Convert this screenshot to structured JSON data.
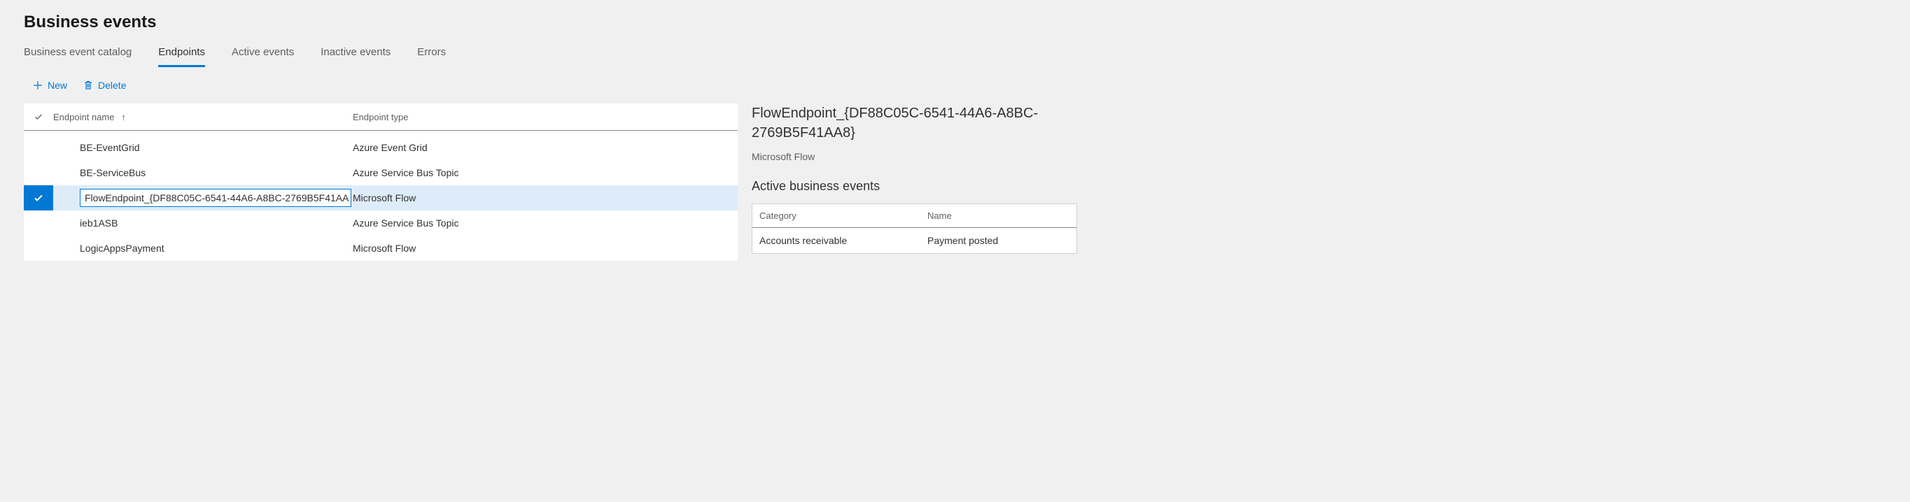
{
  "page_title": "Business events",
  "tabs": [
    {
      "label": "Business event catalog",
      "active": false
    },
    {
      "label": "Endpoints",
      "active": true
    },
    {
      "label": "Active events",
      "active": false
    },
    {
      "label": "Inactive events",
      "active": false
    },
    {
      "label": "Errors",
      "active": false
    }
  ],
  "actions": {
    "new_label": "New",
    "delete_label": "Delete"
  },
  "grid": {
    "headers": {
      "name": "Endpoint name",
      "type": "Endpoint type",
      "sort_indicator": "↑"
    },
    "rows": [
      {
        "name": "BE-EventGrid",
        "type": "Azure Event Grid",
        "selected": false
      },
      {
        "name": "BE-ServiceBus",
        "type": "Azure Service Bus Topic",
        "selected": false
      },
      {
        "name": "FlowEndpoint_{DF88C05C-6541-44A6-A8BC-2769B5F41AA",
        "type": "Microsoft Flow",
        "selected": true
      },
      {
        "name": "ieb1ASB",
        "type": "Azure Service Bus Topic",
        "selected": false
      },
      {
        "name": "LogicAppsPayment",
        "type": "Microsoft Flow",
        "selected": false
      }
    ]
  },
  "detail": {
    "title": "FlowEndpoint_{DF88C05C-6541-44A6-A8BC-2769B5F41AA8}",
    "subtitle": "Microsoft Flow",
    "section_heading": "Active business events",
    "table": {
      "headers": {
        "category": "Category",
        "name": "Name"
      },
      "rows": [
        {
          "category": "Accounts receivable",
          "name": "Payment posted"
        }
      ]
    }
  }
}
